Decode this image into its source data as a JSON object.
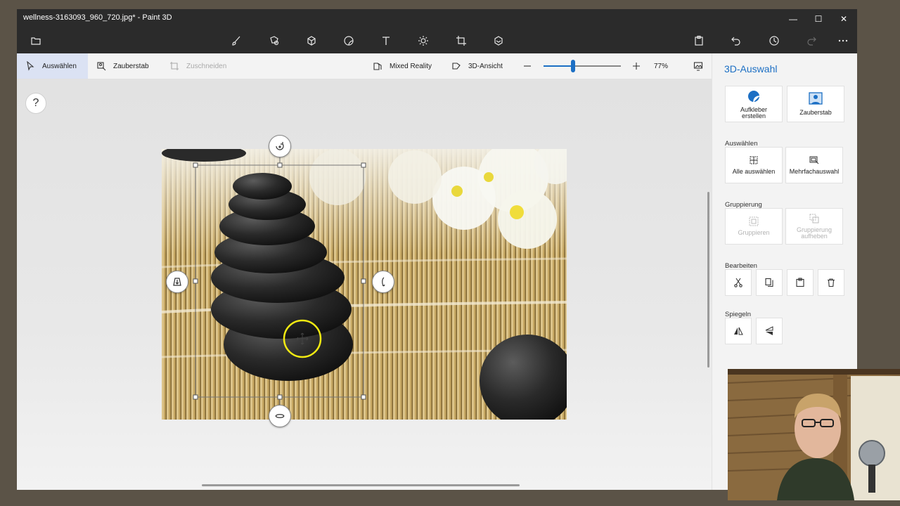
{
  "window": {
    "title": "wellness-3163093_960_720.jpg* - Paint 3D",
    "minimize_label": "—",
    "maximize_label": "☐",
    "close_label": "✕"
  },
  "mainbar": {
    "tools": [
      "menu-folder-icon",
      "brushes-icon",
      "2d-shapes-icon",
      "3d-shapes-icon",
      "stickers-icon",
      "text-icon",
      "effects-icon",
      "canvas-icon",
      "3d-library-icon"
    ],
    "right": [
      "paste-icon",
      "undo-icon",
      "history-icon",
      "redo-icon",
      "more-icon"
    ]
  },
  "toolbar": {
    "select_label": "Auswählen",
    "magic_label": "Zauberstab",
    "crop_label": "Zuschneiden",
    "mixed_reality_label": "Mixed Reality",
    "view3d_label": "3D-Ansicht",
    "zoom_percent": "77%",
    "zoom_level": 0.38
  },
  "canvas": {
    "help_label": "?"
  },
  "panel": {
    "title": "3D-Auswahl",
    "sticker_label": "Aufkleber erstellen",
    "magic_label": "Zauberstab",
    "section_select": "Auswählen",
    "select_all_label": "Alle auswählen",
    "multi_select_label": "Mehrfachauswahl",
    "section_group": "Gruppierung",
    "group_label": "Gruppieren",
    "ungroup_label": "Gruppierung aufheben",
    "section_edit": "Bearbeiten",
    "section_mirror": "Spiegeln"
  },
  "colors": {
    "accent": "#1c6fc4",
    "titlebar": "#2b2b2b",
    "selection_cursor": "#f2ea12"
  }
}
